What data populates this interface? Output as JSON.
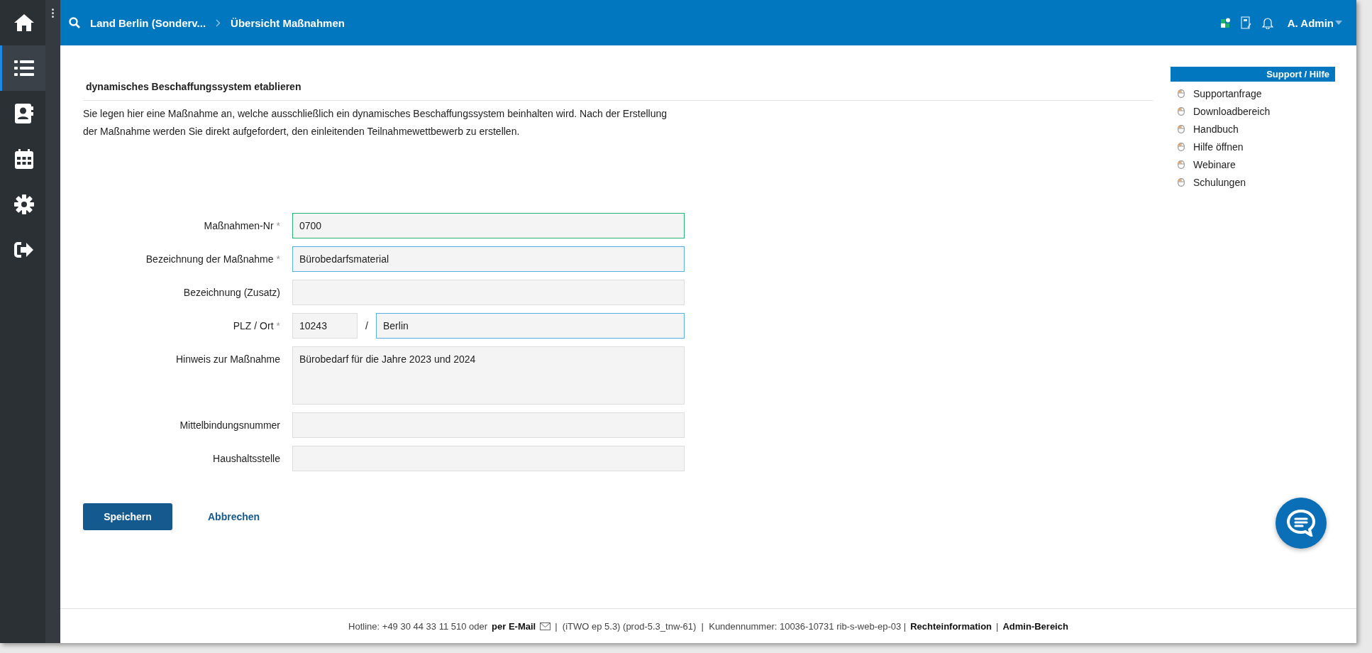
{
  "sidebar": {
    "items": [
      {
        "selected": false
      },
      {
        "selected": true
      },
      {
        "selected": false
      },
      {
        "selected": false
      },
      {
        "selected": false
      },
      {
        "selected": false
      }
    ]
  },
  "topbar": {
    "breadcrumb": [
      "Land Berlin (Sonderv...",
      "Übersicht Maßnahmen"
    ],
    "user": "A. Admin"
  },
  "page": {
    "title": "dynamisches Beschaffungssystem etablieren",
    "description": "Sie legen hier eine Maßnahme an, welche ausschließlich ein dynamisches Beschaffungssystem beinhalten wird. Nach der Erstellung der Maßnahme werden Sie direkt aufgefordert, den einleitenden Teilnahmewettbewerb zu erstellen."
  },
  "form": {
    "fields": [
      {
        "kind": "text",
        "label": "Maßnahmen-Nr",
        "marker": "*",
        "value": "0700",
        "valid": true,
        "focused": false
      },
      {
        "kind": "text",
        "label": "Bezeichnung der Maßnahme",
        "marker": "*",
        "value": "Bürobedarfsmaterial",
        "valid": false,
        "focused": true
      },
      {
        "kind": "text",
        "label": "Bezeichnung (Zusatz)",
        "valid": false,
        "focused": false
      },
      {
        "kind": "zip-city",
        "label": "PLZ / Ort",
        "marker": "*",
        "zip": "10243",
        "separator": "/",
        "value": "Berlin",
        "valid": false,
        "focused": true
      },
      {
        "kind": "textarea",
        "label": "Hinweis zur Maßnahme",
        "value": "Bürobedarf für die Jahre 2023 und 2024",
        "valid": false,
        "focused": false
      },
      {
        "kind": "text",
        "label": "Mittelbindungsnummer",
        "valid": false,
        "focused": false
      },
      {
        "kind": "text",
        "label": "Haushaltsstelle",
        "valid": false,
        "focused": false
      }
    ],
    "save": "Speichern",
    "cancel": "Abbrechen"
  },
  "support": {
    "title": "Support / Hilfe",
    "items": [
      "Supportanfrage",
      "Downloadbereich",
      "Handbuch",
      "Hilfe öffnen",
      "Webinare",
      "Schulungen"
    ]
  },
  "footer": {
    "hotline": "Hotline: +49 30 44 33 11 510 oder",
    "email": "per E-Mail",
    "version": "|  (iTWO ep 5.3) (prod-5.3_tnw-61)  |  Kundennummer: 10036-10731 rib-s-web-ep-03 |",
    "legal": "Rechteinformation",
    "separator": "|",
    "admin": "Admin-Bereich"
  }
}
